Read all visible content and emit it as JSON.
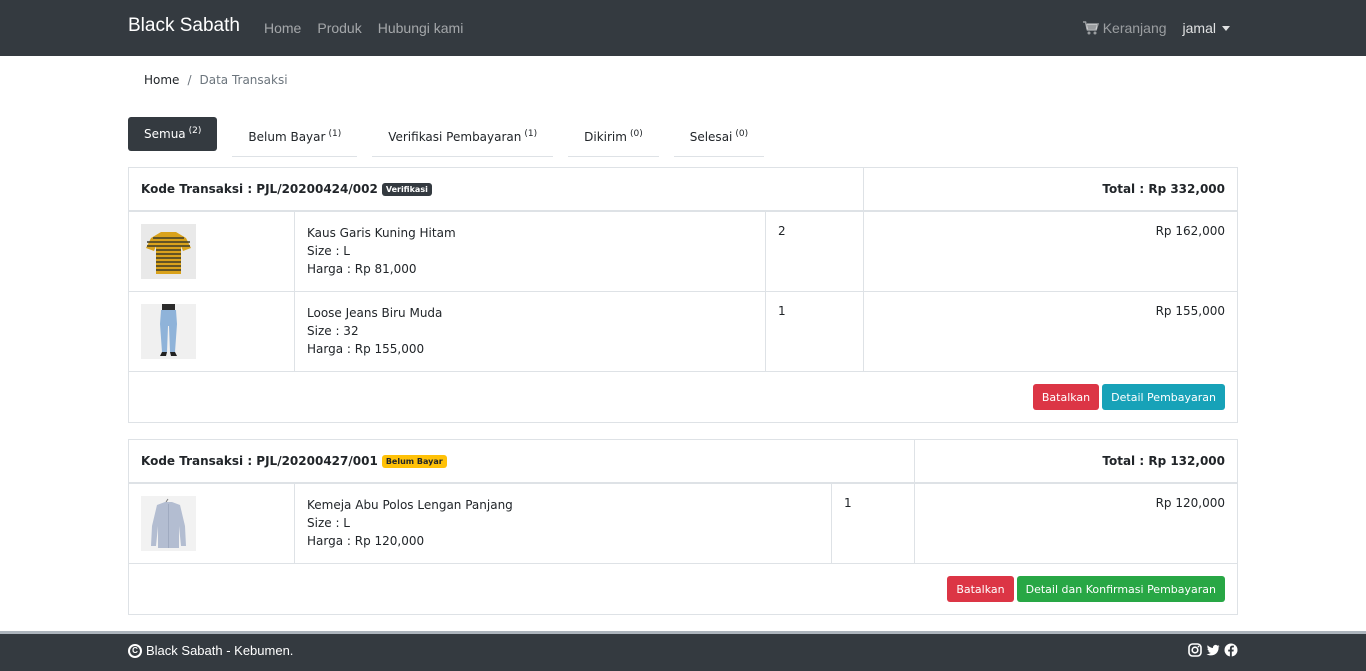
{
  "navbar": {
    "brand": "Black Sabath",
    "links": [
      "Home",
      "Produk",
      "Hubungi kami"
    ],
    "cart_label": "Keranjang",
    "user": "jamal"
  },
  "breadcrumb": {
    "home": "Home",
    "separator": "/",
    "current": "Data Transaksi"
  },
  "tabs": [
    {
      "label": "Semua",
      "count": "(2)"
    },
    {
      "label": "Belum Bayar",
      "count": "(1)"
    },
    {
      "label": "Verifikasi Pembayaran",
      "count": "(1)"
    },
    {
      "label": "Dikirim",
      "count": "(0)"
    },
    {
      "label": "Selesai",
      "count": "(0)"
    }
  ],
  "transactions": [
    {
      "kode": "Kode Transaksi : PJL/20200424/002",
      "status": "Verifikasi",
      "total": "Total : Rp 332,000",
      "items": [
        {
          "name": "Kaus Garis Kuning Hitam",
          "size": "Size : L",
          "harga": "Harga : Rp 81,000",
          "qty": "2",
          "subtotal": "Rp 162,000"
        },
        {
          "name": "Loose Jeans Biru Muda",
          "size": "Size : 32",
          "harga": "Harga : Rp 155,000",
          "qty": "1",
          "subtotal": "Rp 155,000"
        }
      ],
      "buttons": {
        "cancel": "Batalkan",
        "detail": "Detail Pembayaran"
      }
    },
    {
      "kode": "Kode Transaksi : PJL/20200427/001",
      "status": "Belum Bayar",
      "total": "Total : Rp 132,000",
      "items": [
        {
          "name": "Kemeja Abu Polos Lengan Panjang",
          "size": "Size : L",
          "harga": "Harga : Rp 120,000",
          "qty": "1",
          "subtotal": "Rp 120,000"
        }
      ],
      "buttons": {
        "cancel": "Batalkan",
        "detail": "Detail dan Konfirmasi Pembayaran"
      }
    }
  ],
  "footer": {
    "copyright": "Black Sabath - Kebumen.",
    "social_icons": [
      "instagram-icon",
      "twitter-icon",
      "facebook-icon"
    ]
  },
  "colors": {
    "navbar": "#343a40",
    "danger": "#dc3545",
    "info": "#17a2b8",
    "success": "#28a745",
    "warning": "#ffc107"
  }
}
